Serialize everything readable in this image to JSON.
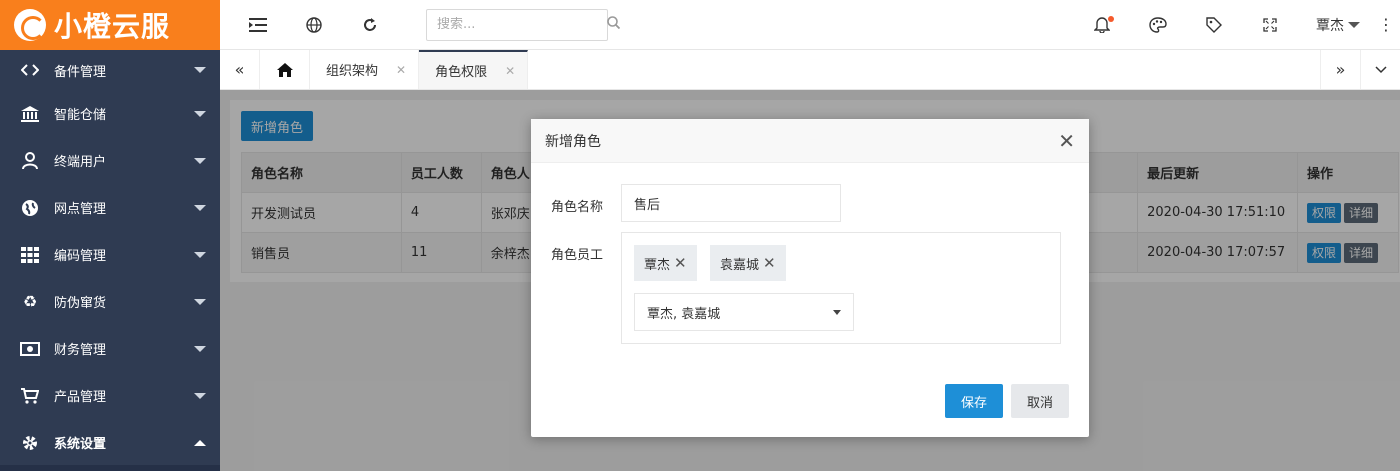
{
  "app": {
    "logo_text": "小橙云服"
  },
  "sidebar": {
    "items": [
      {
        "label": "备件管理",
        "icon": "link-icon",
        "expanded": false
      },
      {
        "label": "智能仓储",
        "icon": "bank-icon",
        "expanded": false
      },
      {
        "label": "终端用户",
        "icon": "user-icon",
        "expanded": false
      },
      {
        "label": "网点管理",
        "icon": "globe-icon",
        "expanded": false
      },
      {
        "label": "编码管理",
        "icon": "grid-icon",
        "expanded": false
      },
      {
        "label": "防伪窜货",
        "icon": "recycle-icon",
        "expanded": false
      },
      {
        "label": "财务管理",
        "icon": "money-icon",
        "expanded": false
      },
      {
        "label": "产品管理",
        "icon": "cart-icon",
        "expanded": false
      },
      {
        "label": "系统设置",
        "icon": "gear-icon",
        "expanded": true
      }
    ]
  },
  "header": {
    "search_placeholder": "搜索...",
    "user_name": "覃杰",
    "notification_dot": true
  },
  "tabs": [
    {
      "label": "组织架构",
      "active": false
    },
    {
      "label": "角色权限",
      "active": true
    }
  ],
  "main": {
    "add_button": "新增角色",
    "columns": [
      "角色名称",
      "员工人数",
      "角色人",
      "最后更新",
      "操作"
    ],
    "rows": [
      {
        "name": "开发测试员",
        "count": "4",
        "members": "张邓庆",
        "updated": "2020-04-30 17:51:10"
      },
      {
        "name": "销售员",
        "count": "11",
        "members": "余梓杰",
        "updated": "2020-04-30 17:07:57"
      }
    ],
    "actions": {
      "permission": "权限",
      "detail": "详细"
    }
  },
  "modal": {
    "title": "新增角色",
    "name_label": "角色名称",
    "name_value": "售后",
    "staff_label": "角色员工",
    "chips": [
      "覃杰",
      "袁嘉城"
    ],
    "select_value": "覃杰, 袁嘉城",
    "save_label": "保存",
    "cancel_label": "取消"
  },
  "colors": {
    "brand_orange": "#f97f1c",
    "sidebar_bg": "#2f3b52",
    "primary_blue": "#1e8fd7"
  }
}
